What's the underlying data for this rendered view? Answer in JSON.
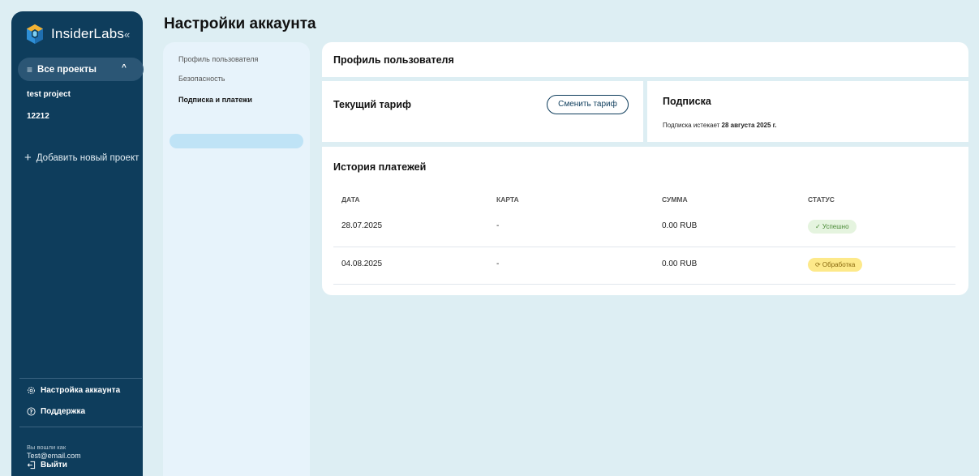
{
  "sidebar": {
    "brand": "InsiderLabs",
    "collapse_icon": "chevrons-left-icon",
    "projects_label": "Все проекты",
    "projects": [
      "test project",
      "12212"
    ],
    "add_project_label": "Добавить новый проект",
    "account_settings_label": "Настройка аккаунта",
    "support_label": "Поддержка",
    "logged_in_as_label": "Вы вошли как",
    "email": "Test@email.com",
    "logout_label": "Выйти"
  },
  "page_title": "Настройки аккаунта",
  "settings_nav": {
    "items": [
      "Профиль пользователя",
      "Безопасность",
      "Подписка и платежи"
    ],
    "active_index": 2
  },
  "profile_card": {
    "title": "Профиль пользователя"
  },
  "tariff_card": {
    "title": "Текущий тариф",
    "button_label": "Сменить тариф"
  },
  "subscription_card": {
    "title": "Подписка",
    "expires_prefix": "Подписка истекает",
    "expires_date": "28 августа 2025 г."
  },
  "payments": {
    "title": "История платежей",
    "columns": [
      "ДАТА",
      "КАРТА",
      "СУММА",
      "СТАТУС"
    ],
    "rows": [
      {
        "date": "28.07.2025",
        "card": "-",
        "amount": "0.00 RUB",
        "status": "✓ Успешно",
        "status_type": "success"
      },
      {
        "date": "04.08.2025",
        "card": "-",
        "amount": "0.00 RUB",
        "status": "⟳ Обработка",
        "status_type": "processing"
      }
    ]
  },
  "colors": {
    "sidebar_bg": "#0e3d5c",
    "page_bg": "#ddeef3",
    "success_bg": "#e5f4df",
    "processing_bg": "#fde98a"
  }
}
